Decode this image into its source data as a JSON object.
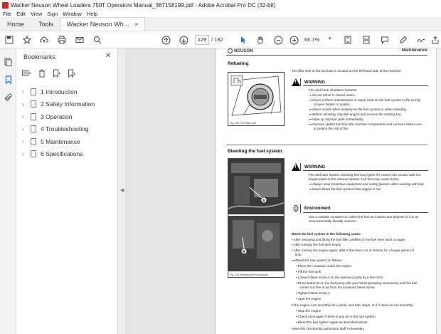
{
  "window": {
    "title": "Wacker Neuson Wheel Loaders 750T Operators Manual_367158199.pdf - Adobe Acrobat Pro DC (32-bit)"
  },
  "menu": [
    "File",
    "Edit",
    "View",
    "Sign",
    "Window",
    "Help"
  ],
  "tabs": {
    "home": "Home",
    "tools": "Tools",
    "document": "Wacker Neuson Wh...",
    "close": "×"
  },
  "toolbar": {
    "current_page": "129",
    "total_pages": "/ 182",
    "zoom": "66.7%"
  },
  "bookmarks": {
    "title": "Bookmarks",
    "items": [
      {
        "label": "1 Introduction"
      },
      {
        "label": "2 Safety Information"
      },
      {
        "label": "3 Operation"
      },
      {
        "label": "4 Troubleshooting"
      },
      {
        "label": "5 Maintenance"
      },
      {
        "label": "6 Specifications"
      }
    ]
  },
  "page": {
    "logo": "NEUSON",
    "section_header": "Maintenance",
    "refueling": {
      "title": "Refueling",
      "intro": "The filler inlet of the fuel tank is located on the left-hand side of the machine",
      "figure_caption": "Fig. 122: Fuel filler inlet",
      "warning_label": "WARNING",
      "warning_lines": [
        "Fire and fume inhalation hazards.",
        "⇒ Do not refuel in closed rooms.",
        "⇒ Never perform maintenance or repair work on the fuel system in the vicinity",
        "of open flames or sparks.",
        "⇒ Never smoke when working on the fuel system or when refueling.",
        "⇒ Before refueling, stop the engine and remove the starting key.",
        "⇒ Wipe up any fuel spills immediately.",
        "⇒ Remove spilled fuel from the machine components and surfaces before use",
        "to reduce the risk of fire."
      ]
    },
    "bleeding": {
      "title": "Bleeding the fuel system",
      "figure_caption": "Fig. 123: Bleeding the fuel system",
      "label_a": "A",
      "label_b": "B",
      "warning_label": "WARNING",
      "warning_lines": [
        "Fire and burn hazard. Draining fuel may ignite if it comes into contact with hot",
        "engine parts or the exhaust system. Hot fuel may cause burns.",
        "⇒ Always wear protective equipment and safety glasses when working with fuel.",
        "⇒ Never bleed the fuel system if the engine is hot."
      ],
      "env_label": "Environment",
      "env_lines": [
        "Use a suitable container to collect the fuel as it drains and dispose of it in an",
        "environmentally friendly manner!"
      ],
      "steps_lines": [
        "Bleed the fuel system in the following cases:",
        "• After removing and fitting the fuel filter, prefilter or the fuel lines back on again",
        "• After running the fuel tank empty",
        "• After running the engine again, after it has been out of service for a longer period of",
        "time",
        "⇒ Bleed the fuel system as follows:",
        "• Place the container under the engine",
        "• Fill the fuel tank",
        "• Loosen bleed screw A on the injection pump by a few turns",
        "• Press button B on the fuel pump with your hand (pumping movement) until the fuel",
        "comes out free of air from the loosened bleed screw",
        "• Tighten bleed screw A",
        "• Start the engine",
        "If the engine runs smoothly for a while, and then stops, or if it does not run smoothly:",
        "• Stop the engine",
        "• Check once again if there is any air in the fuel system",
        "• Bleed the fuel system again as described above",
        "Have this checked by authorized staff if necessary"
      ]
    }
  }
}
